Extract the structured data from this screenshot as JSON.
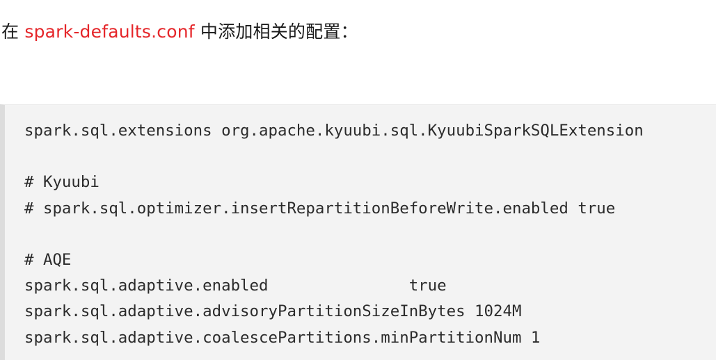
{
  "intro": {
    "prefix": "在 ",
    "filename": "spark-defaults.conf",
    "suffix": " 中添加相关的配置："
  },
  "code_lines": [
    "spark.sql.extensions org.apache.kyuubi.sql.KyuubiSparkSQLExtension",
    "",
    "# Kyuubi",
    "# spark.sql.optimizer.insertRepartitionBeforeWrite.enabled true",
    "",
    "# AQE",
    "spark.sql.adaptive.enabled               true",
    "spark.sql.adaptive.advisoryPartitionSizeInBytes 1024M",
    "spark.sql.adaptive.coalescePartitions.minPartitionNum 1"
  ],
  "colors": {
    "filename_highlight": "#e5262a",
    "code_background": "#f3f3f3",
    "code_border": "#dcdcdc"
  }
}
